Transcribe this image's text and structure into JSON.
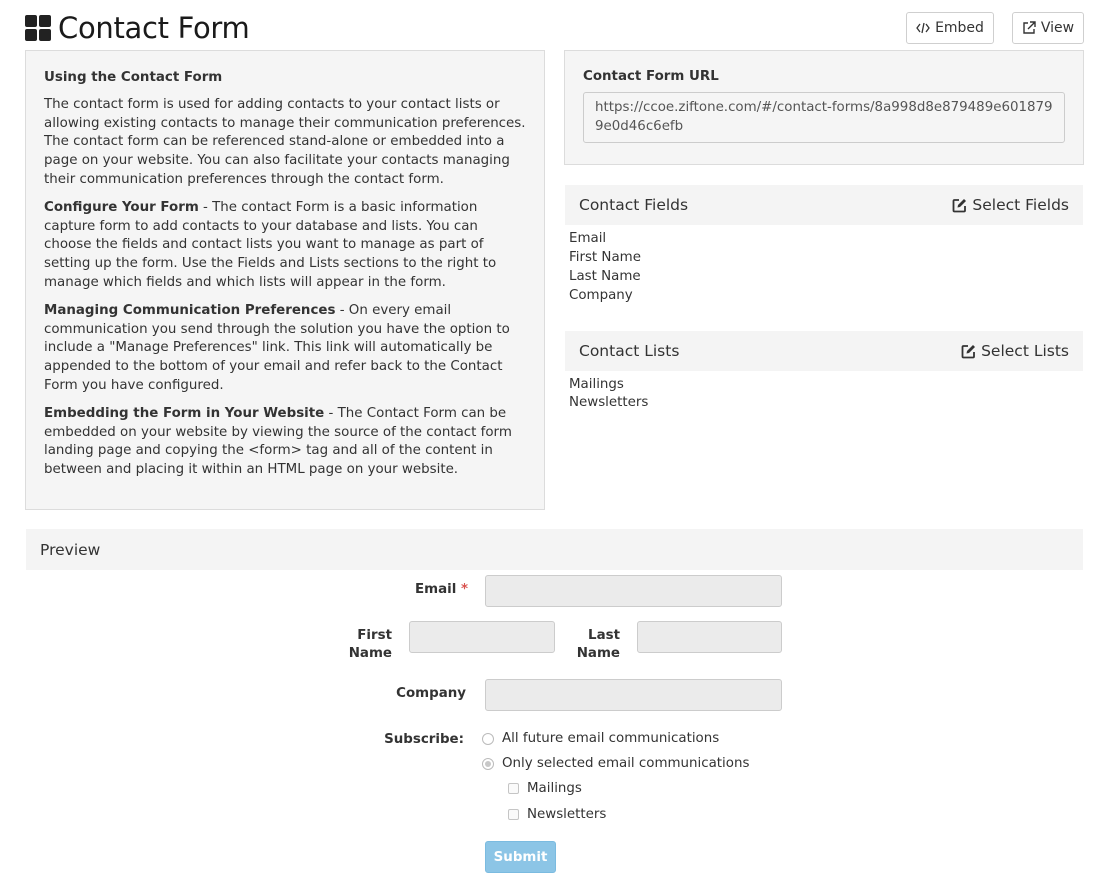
{
  "header": {
    "title": "Contact Form",
    "embed_label": "Embed",
    "view_label": "View"
  },
  "info": {
    "heading": "Using the Contact Form",
    "intro": "The contact form is used for adding contacts to your contact lists or allowing existing contacts to manage their communication preferences. The contact form can be referenced stand-alone or embedded into a page on your website. You can also facilitate your contacts managing their communication preferences through the contact form.",
    "configure_title": "Configure Your Form",
    "configure_text": " - The contact Form is a basic information capture form to add contacts to your database and lists. You can choose the fields and contact lists you want to manage as part of setting up the form. Use the Fields and Lists sections to the right to manage which fields and which lists will appear in the form.",
    "managing_title": "Managing Communication Preferences",
    "managing_text": " - On every email communication you send through the solution you have the option to include a \"Manage Preferences\" link. This link will automatically be appended to the bottom of your email and refer back to the Contact Form you have configured.",
    "embedding_title": "Embedding the Form in Your Website",
    "embedding_text": " - The Contact Form can be embedded on your website by viewing the source of the contact form landing page and copying the <form> tag and all of the content in between and placing it within an HTML page on your website."
  },
  "url_panel": {
    "label": "Contact Form URL",
    "value": "https://ccoe.ziftone.com/#/contact-forms/8a998d8e879489e6018799e0d46c6efb"
  },
  "contact_fields": {
    "title": "Contact Fields",
    "action": "Select Fields",
    "items": [
      "Email",
      "First Name",
      "Last Name",
      "Company"
    ]
  },
  "contact_lists": {
    "title": "Contact Lists",
    "action": "Select Lists",
    "items": [
      "Mailings",
      "Newsletters"
    ]
  },
  "preview": {
    "title": "Preview",
    "email_label": "Email",
    "required_mark": "*",
    "first_name_label": "First Name",
    "last_name_label": "Last Name",
    "company_label": "Company",
    "subscribe_label": "Subscribe:",
    "option_all": "All future email communications",
    "option_selected": "Only selected email communications",
    "list_mailings": "Mailings",
    "list_newsletters": "Newsletters",
    "submit_label": "Submit"
  },
  "colors": {
    "submit_button": "#8cc5e6",
    "required": "#d9534f",
    "panel_bg": "#f5f5f5"
  }
}
